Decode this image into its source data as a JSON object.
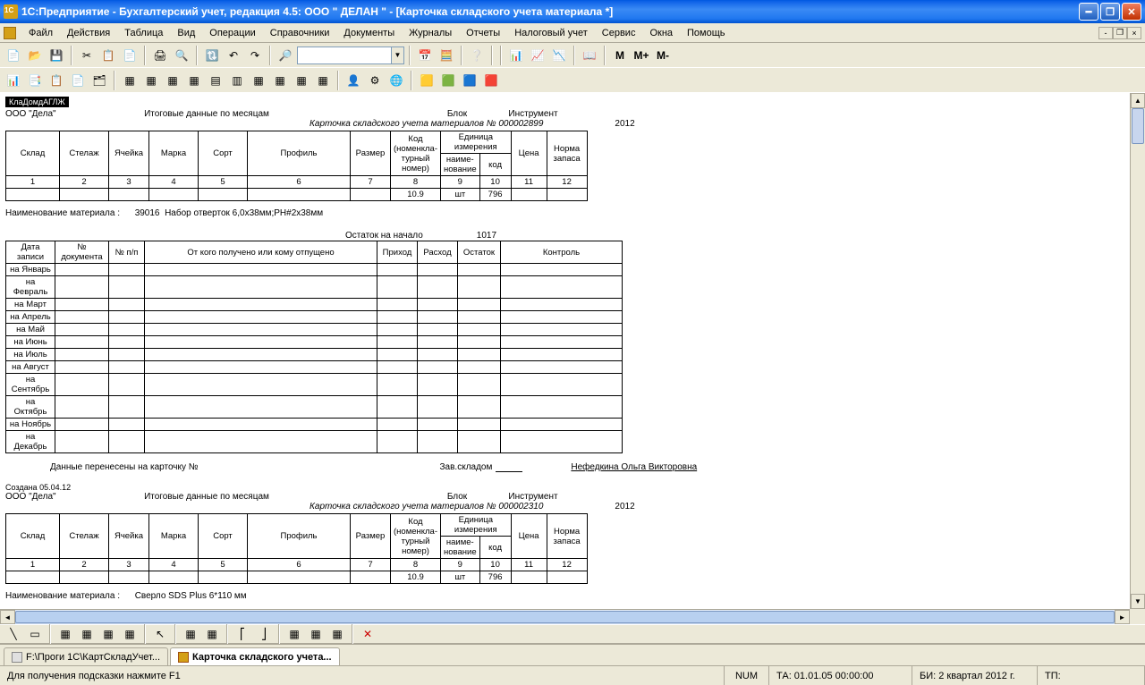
{
  "window": {
    "title": "1С:Предприятие - Бухгалтерский учет, редакция 4.5: ООО \" ДЕЛАН \" - [Карточка складского учета материала *]"
  },
  "menu": {
    "items": [
      "Файл",
      "Действия",
      "Таблица",
      "Вид",
      "Операции",
      "Справочники",
      "Документы",
      "Журналы",
      "Отчеты",
      "Налоговый учет",
      "Сервис",
      "Окна",
      "Помощь"
    ]
  },
  "card1": {
    "tab_marker": "КлаДомдАГЛЖ",
    "org": "ООО \"Дела\"",
    "itog": "Итоговые данные по месяцам",
    "block_lbl": "Блок",
    "instr_lbl": "Инструмент",
    "title": "Карточка складского учета материалов №",
    "number": "000002899",
    "year": "2012",
    "headers": {
      "sklad": "Склад",
      "stelazh": "Стелаж",
      "yacheika": "Ячейка",
      "marka": "Марка",
      "sort": "Сорт",
      "profil": "Профиль",
      "razmer": "Размер",
      "kod": "Код (номенкла-турный номер)",
      "ed_izm": "Единица измерения",
      "naim": "наиме-нование",
      "kod2": "код",
      "cena": "Цена",
      "norma": "Норма запаса"
    },
    "row_nums": [
      "1",
      "2",
      "3",
      "4",
      "5",
      "6",
      "7",
      "8",
      "9",
      "10",
      "11",
      "12"
    ],
    "row_vals": [
      "",
      "",
      "",
      "",
      "",
      "",
      "",
      "10.9",
      "шт",
      "796",
      "",
      ""
    ],
    "mat_lbl": "Наименование материала :",
    "mat_code": "39016",
    "mat_name": "Набор отверток 6,0х38мм;РН#2х38мм",
    "ostatok_lbl": "Остаток на начало",
    "ostatok_val": "1017",
    "mov_headers": [
      "Дата записи",
      "№ документа",
      "№ п/п",
      "От кого получено или кому отпущено",
      "Приход",
      "Расход",
      "Остаток",
      "Контроль"
    ],
    "months": [
      "на Январь",
      "на Февраль",
      "на Март",
      "на Апрель",
      "на Май",
      "на Июнь",
      "на Июль",
      "на Август",
      "на Сентябрь",
      "на Октябрь",
      "на Ноябрь",
      "на Декабрь"
    ],
    "transfer_lbl": "Данные перенесены на карточку №",
    "zav_sklad_lbl": "Зав.складом",
    "person": "Нефедкина Ольга Викторовна",
    "created": "Создана 05.04.12"
  },
  "card2": {
    "org": "ООО \"Дела\"",
    "itog": "Итоговые данные по месяцам",
    "block_lbl": "Блок",
    "instr_lbl": "Инструмент",
    "title": "Карточка складского учета материалов №",
    "number": "000002310",
    "year": "2012",
    "row_vals": [
      "",
      "",
      "",
      "",
      "",
      "",
      "",
      "10.9",
      "шт",
      "796",
      "",
      ""
    ],
    "mat_lbl": "Наименование материала :",
    "mat_name": "Сверло SDS Plus 6*110 мм"
  },
  "tabs": {
    "t1": "F:\\Проги 1С\\КартСкладУчет...",
    "t2": "Карточка складского учета..."
  },
  "status": {
    "hint": "Для получения подсказки нажмите F1",
    "num": "NUM",
    "ta": "ТА: 01.01.05 00:00:00",
    "bi": "БИ: 2 квартал 2012 г.",
    "tp": "ТП:"
  }
}
